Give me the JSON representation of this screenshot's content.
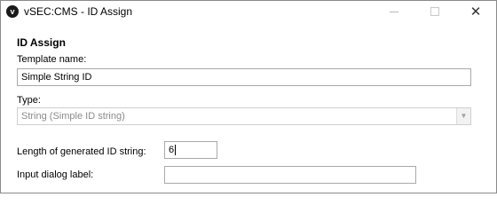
{
  "window": {
    "title": "vSEC:CMS - ID Assign",
    "app_icon": "vsec-logo-icon"
  },
  "section": {
    "heading": "ID Assign"
  },
  "template_name": {
    "label": "Template name:",
    "value": "Simple String ID"
  },
  "type": {
    "label": "Type:",
    "selected": "String (Simple ID string)",
    "disabled": true
  },
  "length": {
    "label": "Length of generated ID string:",
    "value": "6"
  },
  "input_dialog": {
    "label": "Input dialog label:",
    "value": ""
  }
}
